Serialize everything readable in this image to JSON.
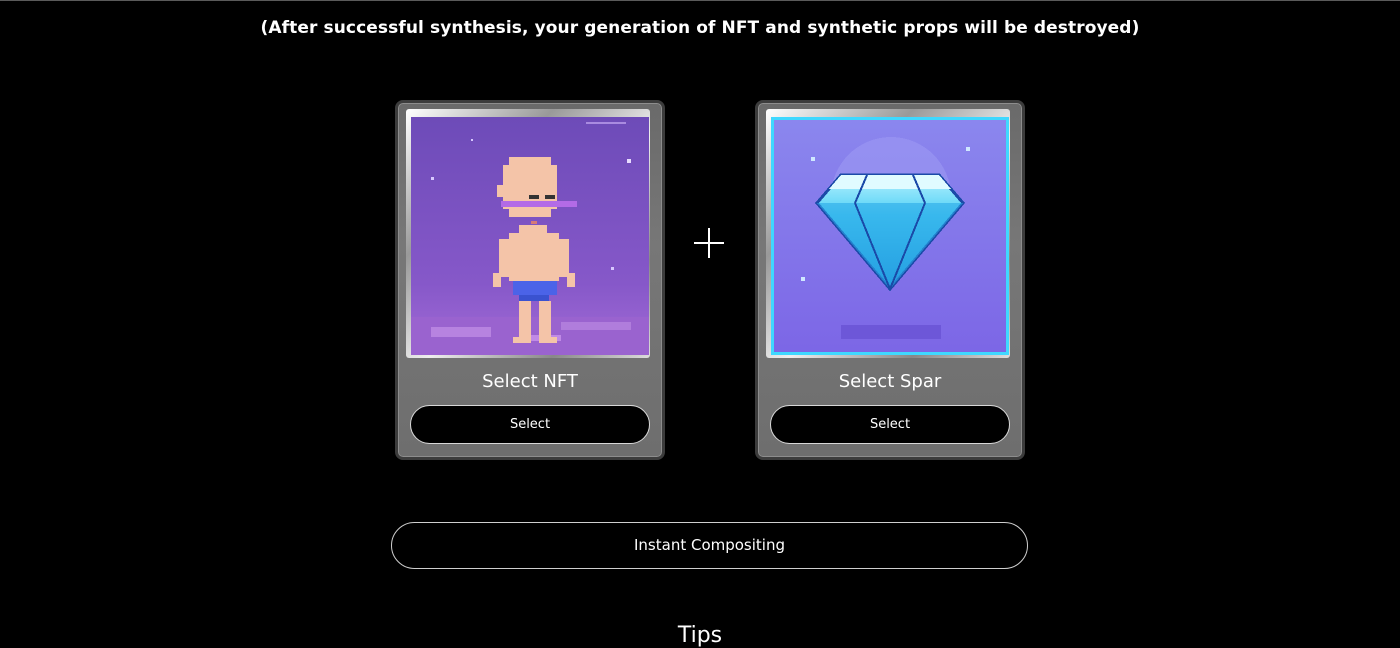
{
  "notice": "(After successful synthesis, your generation of NFT and synthetic props will be destroyed)",
  "cards": [
    {
      "label": "Select NFT",
      "button": "Select",
      "art": "pixel-character-icon"
    },
    {
      "label": "Select Spar",
      "button": "Select",
      "art": "pixel-diamond-icon"
    }
  ],
  "plus_icon": "plus-icon",
  "compose_button": "Instant Compositing",
  "tips_heading": "Tips",
  "colors": {
    "background": "#000000",
    "card": "#6e6e6e",
    "nft_art_bg": "#7b55c4",
    "spar_art_bg": "#8f8cf0",
    "diamond": "#34c6f0"
  }
}
